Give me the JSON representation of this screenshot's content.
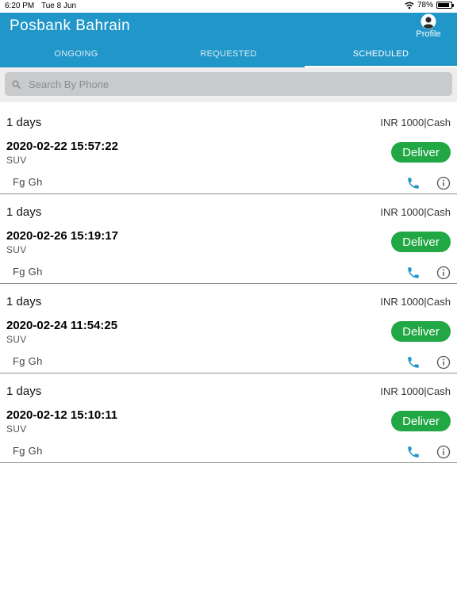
{
  "status_bar": {
    "time": "6:20 PM",
    "date": "Tue 8 Jun",
    "battery": "78%",
    "battery_level": 0.78
  },
  "header": {
    "title": "Posbank Bahrain",
    "profile_label": "Profile"
  },
  "tabs": [
    {
      "label": "ONGOING",
      "active": false
    },
    {
      "label": "REQUESTED",
      "active": false
    },
    {
      "label": "SCHEDULED",
      "active": true
    }
  ],
  "search": {
    "placeholder": "Search By Phone",
    "value": ""
  },
  "colors": {
    "primary": "#2196c9",
    "deliver": "#21a744",
    "call_icon": "#2196c9"
  },
  "rides": [
    {
      "days": "1 days",
      "fare": "INR 1000|Cash",
      "datetime": "2020-02-22 15:57:22",
      "vehicle": "SUV",
      "customer": "Fg Gh",
      "action_label": "Deliver"
    },
    {
      "days": "1 days",
      "fare": "INR 1000|Cash",
      "datetime": "2020-02-26 15:19:17",
      "vehicle": "SUV",
      "customer": "Fg Gh",
      "action_label": "Deliver"
    },
    {
      "days": "1 days",
      "fare": "INR 1000|Cash",
      "datetime": "2020-02-24 11:54:25",
      "vehicle": "SUV",
      "customer": "Fg Gh",
      "action_label": "Deliver"
    },
    {
      "days": "1 days",
      "fare": "INR 1000|Cash",
      "datetime": "2020-02-12 15:10:11",
      "vehicle": "SUV",
      "customer": "Fg Gh",
      "action_label": "Deliver"
    }
  ],
  "icons": {
    "call": "phone-icon",
    "info": "info-icon",
    "search": "search-icon",
    "profile": "avatar-icon",
    "wifi": "wifi-icon",
    "battery": "battery-icon"
  }
}
